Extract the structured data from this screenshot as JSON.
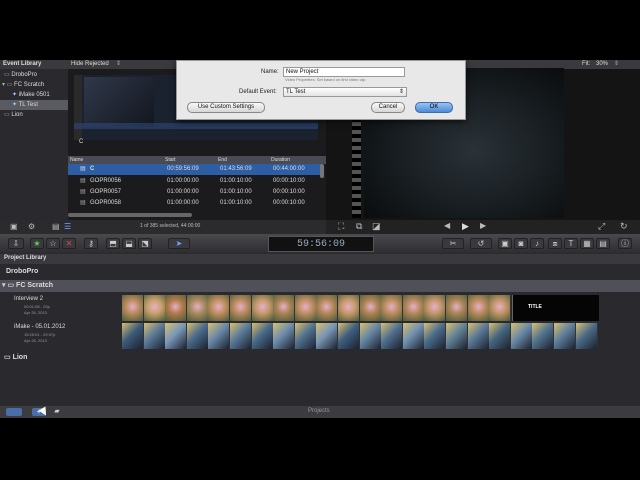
{
  "event_library": {
    "header": "Event Library",
    "items": [
      {
        "label": "DroboPro"
      },
      {
        "label": "FC Scratch"
      },
      {
        "label": "iMake 0501"
      },
      {
        "label": "TL Test"
      },
      {
        "label": "Lion"
      }
    ]
  },
  "browser": {
    "filter": "Hide Rejected",
    "clip_label": "C",
    "columns": [
      "Name",
      "Start",
      "End",
      "Duration"
    ],
    "rows": [
      {
        "name": "C",
        "start": "00:59:56:09",
        "end": "01:43:56:09",
        "duration": "00:44:00:00"
      },
      {
        "name": "GOPR0056",
        "start": "01:00:00:00",
        "end": "01:00:10:00",
        "duration": "00:00:10:00"
      },
      {
        "name": "GOPR0057",
        "start": "01:00:00:00",
        "end": "01:00:10:00",
        "duration": "00:00:10:00"
      },
      {
        "name": "GOPR0058",
        "start": "01:00:00:00",
        "end": "01:00:10:00",
        "duration": "00:00:10:00"
      }
    ],
    "selection_status": "1 of 385 selected, 44:00:00"
  },
  "viewer": {
    "fit_label": "Fit:",
    "fit_value": "30%"
  },
  "dialog": {
    "name_label": "Name:",
    "name_value": "New Project",
    "hint": "Video Properties: Set based on first video clip",
    "event_label": "Default Event:",
    "event_value": "TL Test",
    "custom_button": "Use Custom Settings",
    "cancel_button": "Cancel",
    "ok_button": "OK"
  },
  "toolbar": {
    "timecode": "59:56:09"
  },
  "project_library": {
    "header": "Project Library",
    "groups": [
      {
        "label": "DroboPro"
      },
      {
        "label": "FC Scratch"
      },
      {
        "label": "Lion"
      }
    ],
    "projects": [
      {
        "name": "Interview 2",
        "meta1": "00:01:08 - 29p",
        "meta2": "Apr 26, 2013",
        "title_clip": "TITLE"
      },
      {
        "name": "iMake - 05.01.2012",
        "meta1": "19:25:01 - 29.97p",
        "meta2": "Apr 26, 2013"
      }
    ]
  },
  "footer": {
    "label": "Projects"
  },
  "colors": {
    "selection_blue": "#2d5da3",
    "ok_blue": "#4d8ad6"
  }
}
